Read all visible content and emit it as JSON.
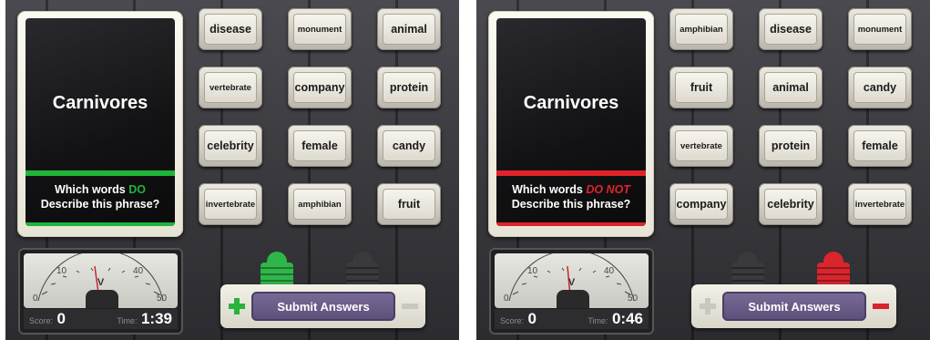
{
  "colors": {
    "do_green": "#1fb53a",
    "do_not_red": "#e0232b",
    "lamp_green": "#2fb64a",
    "lamp_red": "#d9262d",
    "lamp_off": "#3a3a3d",
    "plus_green": "#28b23e",
    "minus_red": "#d8232b",
    "disabled_grey": "#c9c7be"
  },
  "panels": [
    {
      "mode": "do",
      "prompt": {
        "word": "Carnivores",
        "question_prefix": "Which words",
        "keyword": "DO",
        "question_line2": "Describe this phrase?"
      },
      "words": [
        "disease",
        "monument",
        "animal",
        "vertebrate",
        "company",
        "protein",
        "celebrity",
        "female",
        "candy",
        "invertebrate",
        "amphibian",
        "fruit"
      ],
      "meter": {
        "score_label": "Score:",
        "score": "0",
        "time_label": "Time:",
        "time": "1:39"
      },
      "submit_label": "Submit Answers"
    },
    {
      "mode": "do-not",
      "prompt": {
        "word": "Carnivores",
        "question_prefix": "Which words",
        "keyword": "DO NOT",
        "question_line2": "Describe this phrase?"
      },
      "words": [
        "amphibian",
        "disease",
        "monument",
        "fruit",
        "animal",
        "candy",
        "vertebrate",
        "protein",
        "female",
        "company",
        "celebrity",
        "invertebrate"
      ],
      "meter": {
        "score_label": "Score:",
        "score": "0",
        "time_label": "Time:",
        "time": "0:46"
      },
      "submit_label": "Submit Answers"
    }
  ],
  "meter_scale": {
    "ticks": [
      "0",
      "10",
      "V",
      "40",
      "50"
    ]
  }
}
